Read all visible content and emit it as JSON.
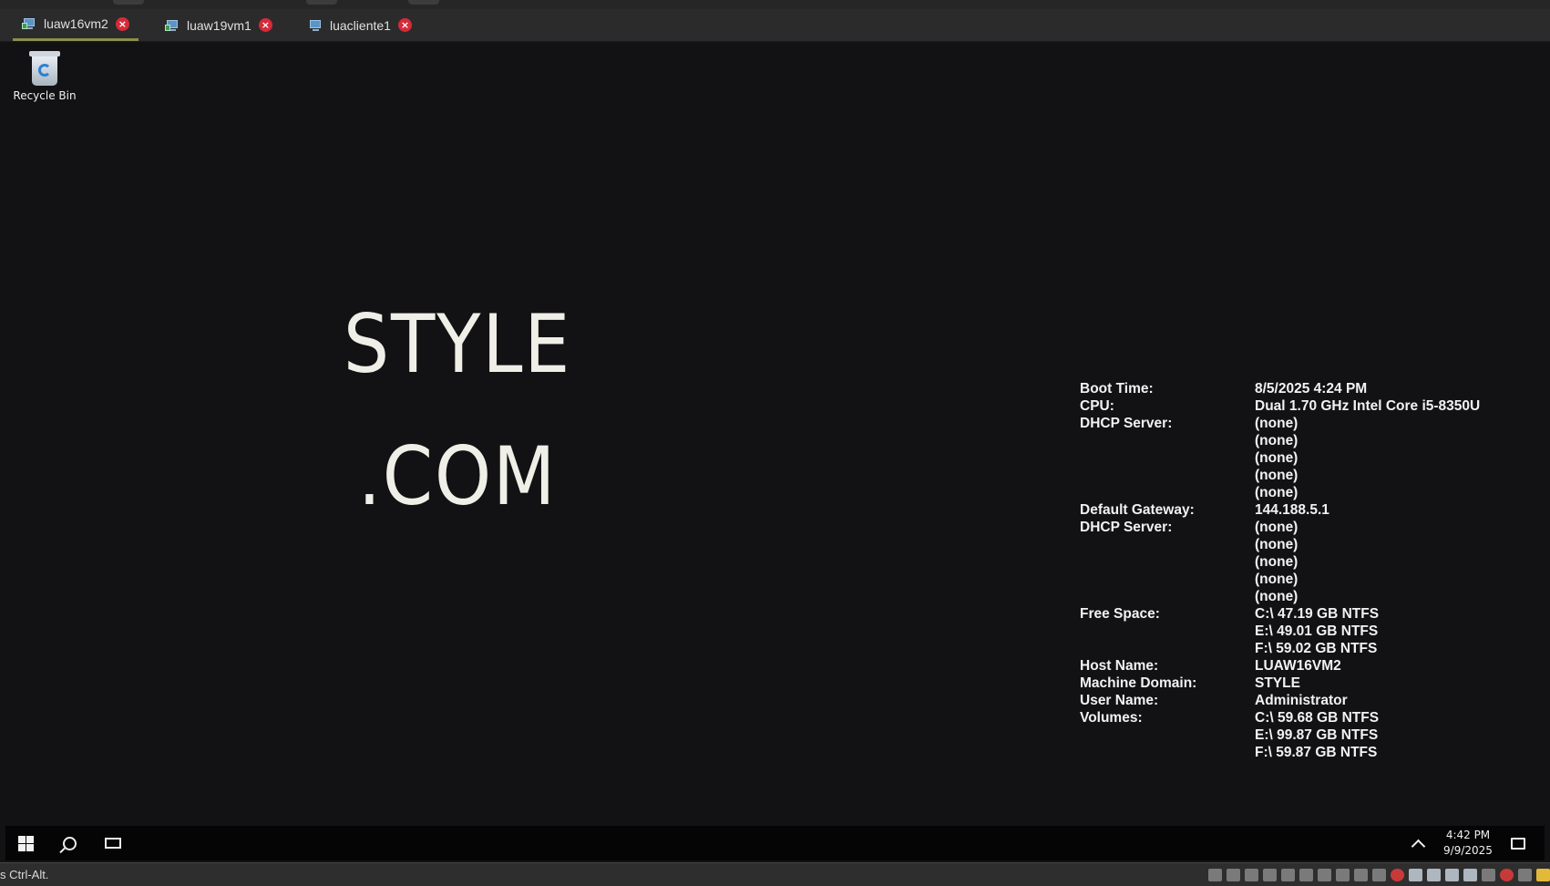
{
  "tabs": [
    {
      "label": "luaw16vm2",
      "active": true
    },
    {
      "label": "luaw19vm1",
      "active": false
    },
    {
      "label": "luacliente1",
      "active": false
    }
  ],
  "desktop": {
    "recycle_bin_label": "Recycle Bin",
    "brand_line1": "STYLE",
    "brand_line2": ".COM"
  },
  "bginfo": [
    {
      "key": "Boot Time:",
      "value": "8/5/2025 4:24 PM"
    },
    {
      "key": "CPU:",
      "value": "Dual 1.70 GHz Intel Core i5-8350U"
    },
    {
      "key": "DHCP Server:",
      "value": "(none)"
    },
    {
      "key": "",
      "value": "(none)"
    },
    {
      "key": "",
      "value": "(none)"
    },
    {
      "key": "",
      "value": "(none)"
    },
    {
      "key": "",
      "value": "(none)"
    },
    {
      "key": "Default Gateway:",
      "value": "144.188.5.1"
    },
    {
      "key": "DHCP Server:",
      "value": "(none)"
    },
    {
      "key": "",
      "value": "(none)"
    },
    {
      "key": "",
      "value": "(none)"
    },
    {
      "key": "",
      "value": "(none)"
    },
    {
      "key": "",
      "value": "(none)"
    },
    {
      "key": "Free Space:",
      "value": "C:\\ 47.19 GB NTFS"
    },
    {
      "key": "",
      "value": "E:\\ 49.01 GB NTFS"
    },
    {
      "key": "",
      "value": "F:\\ 59.02 GB NTFS"
    },
    {
      "key": "Host Name:",
      "value": "LUAW16VM2"
    },
    {
      "key": "Machine Domain:",
      "value": "STYLE"
    },
    {
      "key": "User Name:",
      "value": "Administrator"
    },
    {
      "key": "Volumes:",
      "value": "C:\\ 59.68 GB NTFS"
    },
    {
      "key": "",
      "value": "E:\\ 99.87 GB NTFS"
    },
    {
      "key": "",
      "value": "F:\\ 59.87 GB NTFS"
    }
  ],
  "taskbar": {
    "time": "4:42 PM",
    "date": "9/9/2025"
  },
  "statusbar": {
    "hint": "s Ctrl-Alt."
  },
  "colors": {
    "desktop_bg": "#121214",
    "tab_close": "#d62a3a",
    "active_tab_underline": "#8a8f4e"
  }
}
